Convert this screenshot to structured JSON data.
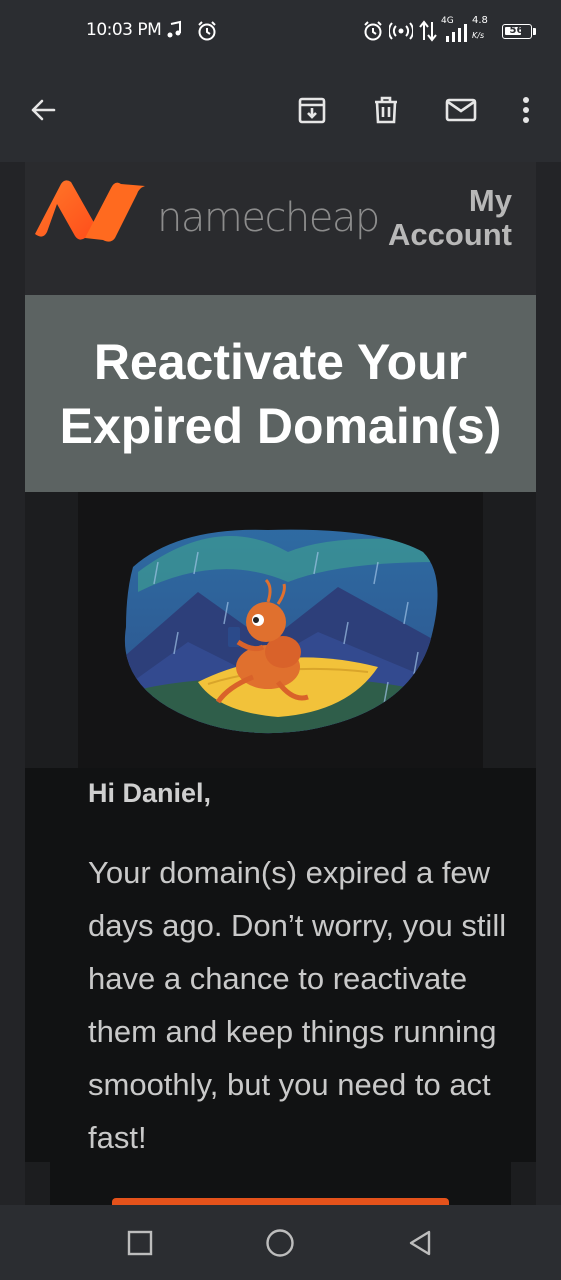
{
  "status_bar": {
    "time": "10:03 PM",
    "network_type": "4G",
    "speed_value": "4.8",
    "speed_unit": "K/s",
    "battery_level": "56",
    "icons": [
      "music-icon",
      "alarm-icon",
      "alarm-icon",
      "hotspot-icon",
      "data-arrows-icon",
      "signal-icon",
      "battery-icon"
    ]
  },
  "app_bar": {
    "icons": [
      "back-arrow-icon",
      "archive-icon",
      "delete-icon",
      "mark-unread-icon",
      "more-vert-icon"
    ]
  },
  "email": {
    "brand_name": "namecheap",
    "my_account_label": "My Account",
    "banner_title": "Reactivate Your Expired Domain(s)",
    "greeting": "Hi Daniel,",
    "body": "Your domain(s) expired a few days ago. Don’t worry, you still have a chance to reactivate them and keep things running smoothly, but you need to act fast!",
    "colors": {
      "brand_orange": "#ff6a1f",
      "banner_bg": "#5c6362",
      "cta_orange": "#e4521b"
    }
  },
  "nav_bar": {
    "icons": [
      "recents-square-icon",
      "home-circle-icon",
      "back-triangle-icon"
    ]
  }
}
